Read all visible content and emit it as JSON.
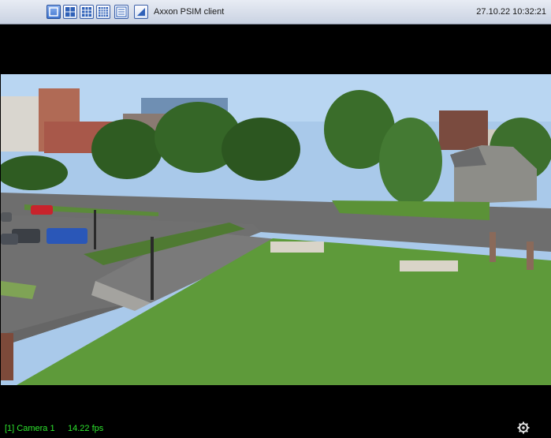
{
  "app": {
    "title": "Axxon PSIM client",
    "datetime": "27.10.22 10:32:21"
  },
  "toolbar": {
    "buttons": [
      {
        "name": "layout-1x1",
        "active": true
      },
      {
        "name": "layout-2x2",
        "active": false
      },
      {
        "name": "layout-3x3",
        "active": false
      },
      {
        "name": "layout-4x4",
        "active": false
      },
      {
        "name": "camera-list",
        "active": false
      },
      {
        "name": "maximize",
        "active": false
      }
    ]
  },
  "camera": {
    "label": "[1] Camera 1",
    "fps": "14.22 fps"
  },
  "colors": {
    "status_text": "#2ee62e",
    "toolbar_accent": "#3f74cf"
  },
  "icons": [
    "grid-1x1-icon",
    "grid-2x2-icon",
    "grid-3x3-icon",
    "grid-4x4-icon",
    "list-icon",
    "expand-icon",
    "settings-icon"
  ]
}
